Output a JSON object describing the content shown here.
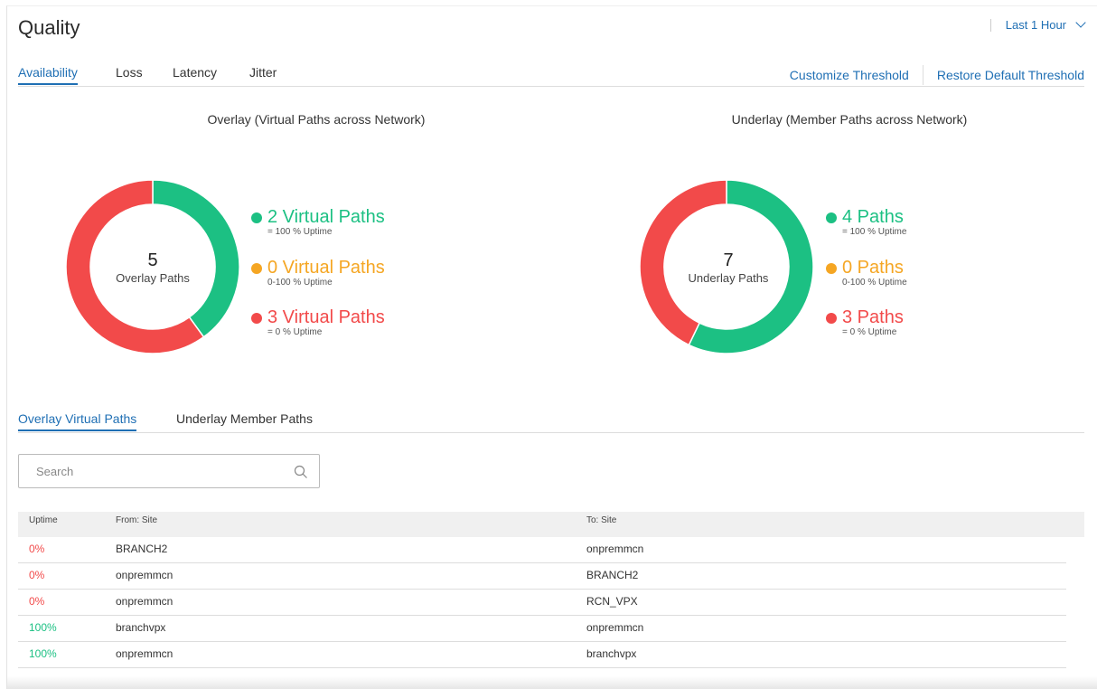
{
  "header": {
    "title": "Quality",
    "time_range": "Last 1 Hour"
  },
  "metric_tabs": [
    "Availability",
    "Loss",
    "Latency",
    "Jitter"
  ],
  "actions": {
    "customize": "Customize Threshold",
    "restore": "Restore Default Threshold"
  },
  "colors": {
    "green": "#1cc083",
    "orange": "#f5a623",
    "red": "#f24a4a",
    "accent": "#1f6fb4"
  },
  "overlay": {
    "title": "Overlay (Virtual Paths across Network)",
    "total": "5",
    "total_label": "Overlay Paths",
    "legend": [
      {
        "label": "2 Virtual Paths",
        "sub": "= 100 % Uptime",
        "color": "#1cc083",
        "value": 2
      },
      {
        "label": "0 Virtual Paths",
        "sub": "0-100 % Uptime",
        "color": "#f5a623",
        "value": 0
      },
      {
        "label": "3 Virtual Paths",
        "sub": "= 0 % Uptime",
        "color": "#f24a4a",
        "value": 3
      }
    ]
  },
  "underlay": {
    "title": "Underlay (Member Paths across Network)",
    "total": "7",
    "total_label": "Underlay Paths",
    "legend": [
      {
        "label": "4 Paths",
        "sub": "= 100 % Uptime",
        "color": "#1cc083",
        "value": 4
      },
      {
        "label": "0 Paths",
        "sub": "0-100 % Uptime",
        "color": "#f5a623",
        "value": 0
      },
      {
        "label": "3 Paths",
        "sub": "= 0 % Uptime",
        "color": "#f24a4a",
        "value": 3
      }
    ]
  },
  "path_tabs": [
    "Overlay Virtual Paths",
    "Underlay Member Paths"
  ],
  "search": {
    "placeholder": "Search"
  },
  "table": {
    "columns": [
      "Uptime",
      "From: Site",
      "To: Site"
    ],
    "rows": [
      {
        "uptime": "0%",
        "from": "BRANCH2",
        "to": "onpremmcn",
        "status": "down"
      },
      {
        "uptime": "0%",
        "from": "onpremmcn",
        "to": "BRANCH2",
        "status": "down"
      },
      {
        "uptime": "0%",
        "from": "onpremmcn",
        "to": "RCN_VPX",
        "status": "down"
      },
      {
        "uptime": "100%",
        "from": "branchvpx",
        "to": "onpremmcn",
        "status": "up"
      },
      {
        "uptime": "100%",
        "from": "onpremmcn",
        "to": "branchvpx",
        "status": "up"
      }
    ]
  }
}
